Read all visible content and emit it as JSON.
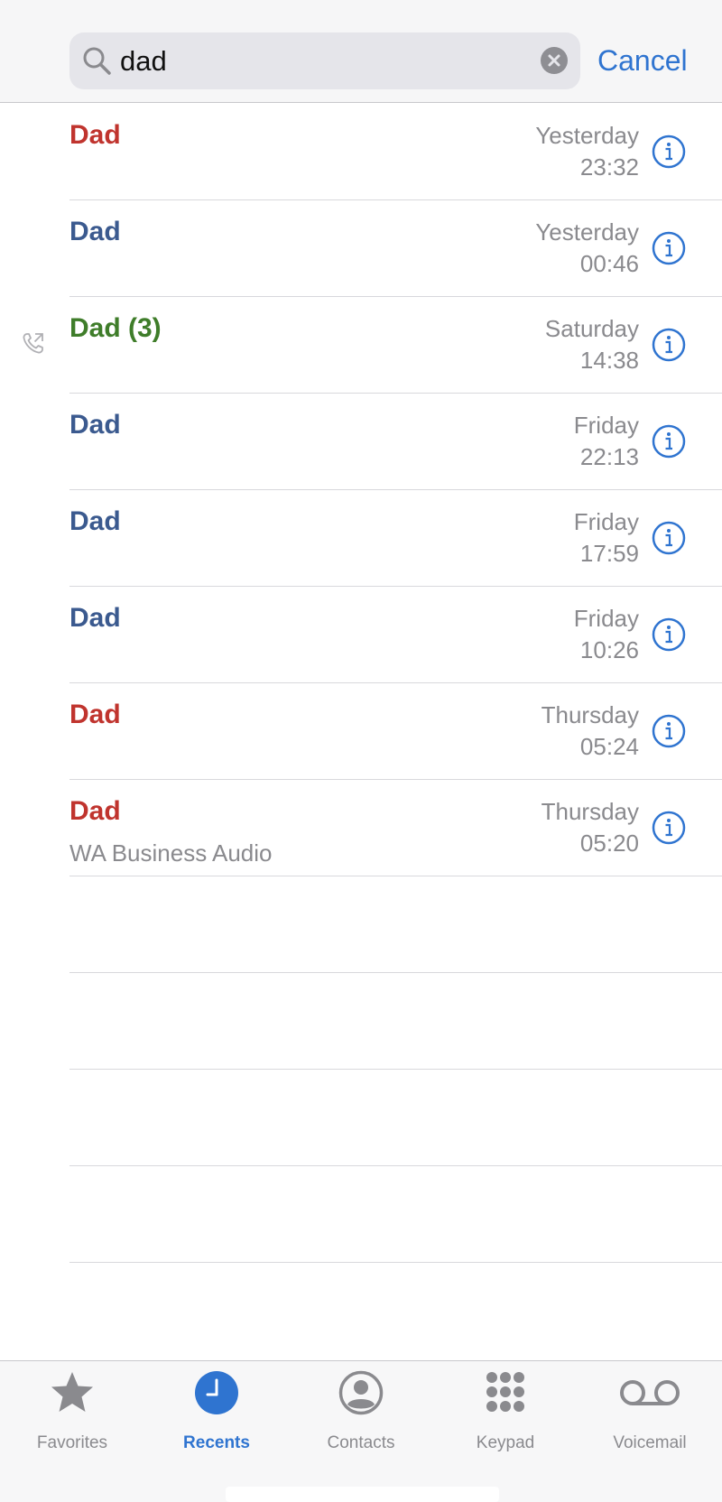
{
  "search": {
    "query": "dad",
    "cancel_label": "Cancel"
  },
  "colors": {
    "missed": "#c0342e",
    "normal": "#3b5a8f",
    "outgoing": "#3f7d2a",
    "accent": "#2f74d0",
    "secondary": "#8a8a8e"
  },
  "calls": [
    {
      "name": "Dad",
      "kind": "missed",
      "day": "Yesterday",
      "time": "23:32",
      "subtitle": ""
    },
    {
      "name": "Dad",
      "kind": "normal",
      "day": "Yesterday",
      "time": "00:46",
      "subtitle": ""
    },
    {
      "name": "Dad (3)",
      "kind": "outgoing",
      "day": "Saturday",
      "time": "14:38",
      "subtitle": "",
      "icon": "outgoing-call-icon"
    },
    {
      "name": "Dad",
      "kind": "normal",
      "day": "Friday",
      "time": "22:13",
      "subtitle": ""
    },
    {
      "name": "Dad",
      "kind": "normal",
      "day": "Friday",
      "time": "17:59",
      "subtitle": ""
    },
    {
      "name": "Dad",
      "kind": "normal",
      "day": "Friday",
      "time": "10:26",
      "subtitle": ""
    },
    {
      "name": "Dad",
      "kind": "missed",
      "day": "Thursday",
      "time": "05:24",
      "subtitle": ""
    },
    {
      "name": "Dad",
      "kind": "missed",
      "day": "Thursday",
      "time": "05:20",
      "subtitle": "WA Business Audio"
    }
  ],
  "tabs": [
    {
      "label": "Favorites",
      "icon": "star-icon",
      "active": false
    },
    {
      "label": "Recents",
      "icon": "clock-icon",
      "active": true
    },
    {
      "label": "Contacts",
      "icon": "person-circle-icon",
      "active": false
    },
    {
      "label": "Keypad",
      "icon": "keypad-icon",
      "active": false
    },
    {
      "label": "Voicemail",
      "icon": "voicemail-icon",
      "active": false
    }
  ]
}
